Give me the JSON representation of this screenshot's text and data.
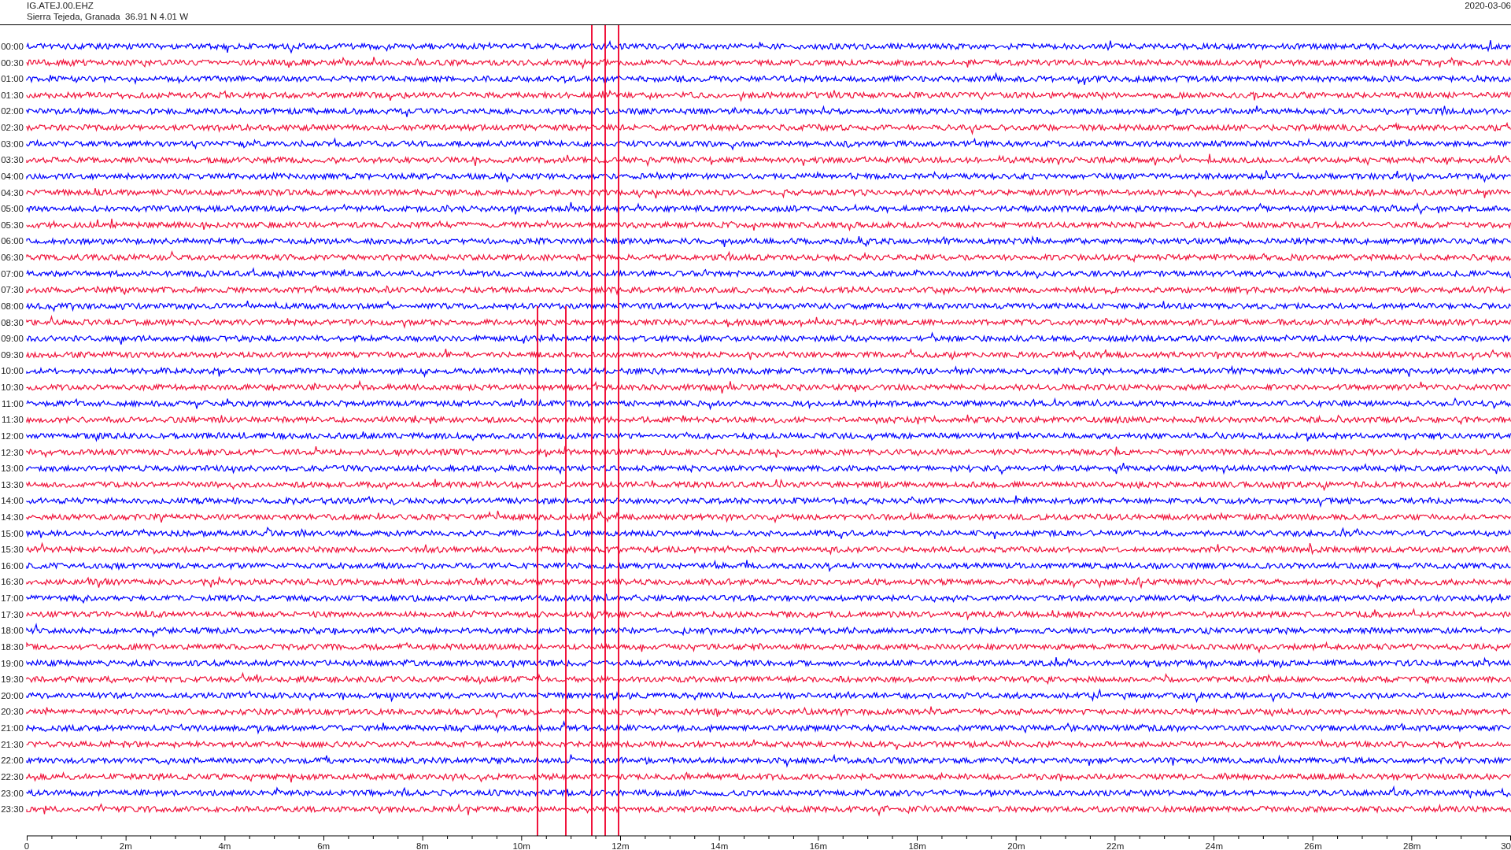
{
  "header": {
    "station": "IG.ATEJ.00.EHZ",
    "location": "Sierra Tejeda, Granada  36.91 N 4.01 W",
    "date": "2020-03-06"
  },
  "traces": [
    {
      "label": "00:00",
      "color": "#0000ff"
    },
    {
      "label": "00:30",
      "color": "#f0143c"
    },
    {
      "label": "01:00",
      "color": "#0000ff"
    },
    {
      "label": "01:30",
      "color": "#f0143c"
    },
    {
      "label": "02:00",
      "color": "#0000ff"
    },
    {
      "label": "02:30",
      "color": "#f0143c"
    },
    {
      "label": "03:00",
      "color": "#0000ff"
    },
    {
      "label": "03:30",
      "color": "#f0143c"
    },
    {
      "label": "04:00",
      "color": "#0000ff"
    },
    {
      "label": "04:30",
      "color": "#f0143c"
    },
    {
      "label": "05:00",
      "color": "#0000ff"
    },
    {
      "label": "05:30",
      "color": "#f0143c"
    },
    {
      "label": "06:00",
      "color": "#0000ff"
    },
    {
      "label": "06:30",
      "color": "#f0143c"
    },
    {
      "label": "07:00",
      "color": "#0000ff"
    },
    {
      "label": "07:30",
      "color": "#f0143c"
    },
    {
      "label": "08:00",
      "color": "#0000ff"
    },
    {
      "label": "08:30",
      "color": "#f0143c"
    },
    {
      "label": "09:00",
      "color": "#0000ff"
    },
    {
      "label": "09:30",
      "color": "#f0143c"
    },
    {
      "label": "10:00",
      "color": "#0000ff"
    },
    {
      "label": "10:30",
      "color": "#f0143c"
    },
    {
      "label": "11:00",
      "color": "#0000ff"
    },
    {
      "label": "11:30",
      "color": "#f0143c"
    },
    {
      "label": "12:00",
      "color": "#0000ff"
    },
    {
      "label": "12:30",
      "color": "#f0143c"
    },
    {
      "label": "13:00",
      "color": "#0000ff"
    },
    {
      "label": "13:30",
      "color": "#f0143c"
    },
    {
      "label": "14:00",
      "color": "#0000ff"
    },
    {
      "label": "14:30",
      "color": "#f0143c"
    },
    {
      "label": "15:00",
      "color": "#0000ff"
    },
    {
      "label": "15:30",
      "color": "#f0143c"
    },
    {
      "label": "16:00",
      "color": "#0000ff"
    },
    {
      "label": "16:30",
      "color": "#f0143c"
    },
    {
      "label": "17:00",
      "color": "#0000ff"
    },
    {
      "label": "17:30",
      "color": "#f0143c"
    },
    {
      "label": "18:00",
      "color": "#0000ff"
    },
    {
      "label": "18:30",
      "color": "#f0143c"
    },
    {
      "label": "19:00",
      "color": "#0000ff"
    },
    {
      "label": "19:30",
      "color": "#f0143c"
    },
    {
      "label": "20:00",
      "color": "#0000ff"
    },
    {
      "label": "20:30",
      "color": "#f0143c"
    },
    {
      "label": "21:00",
      "color": "#0000ff"
    },
    {
      "label": "21:30",
      "color": "#f0143c"
    },
    {
      "label": "22:00",
      "color": "#0000ff"
    },
    {
      "label": "22:30",
      "color": "#f0143c"
    },
    {
      "label": "23:00",
      "color": "#0000ff"
    },
    {
      "label": "23:30",
      "color": "#f0143c"
    }
  ],
  "x_axis": {
    "ticks": [
      "0",
      "2m",
      "4m",
      "6m",
      "8m",
      "10m",
      "12m",
      "14m",
      "16m",
      "18m",
      "20m",
      "22m",
      "24m",
      "26m",
      "28m",
      "30"
    ]
  }
}
